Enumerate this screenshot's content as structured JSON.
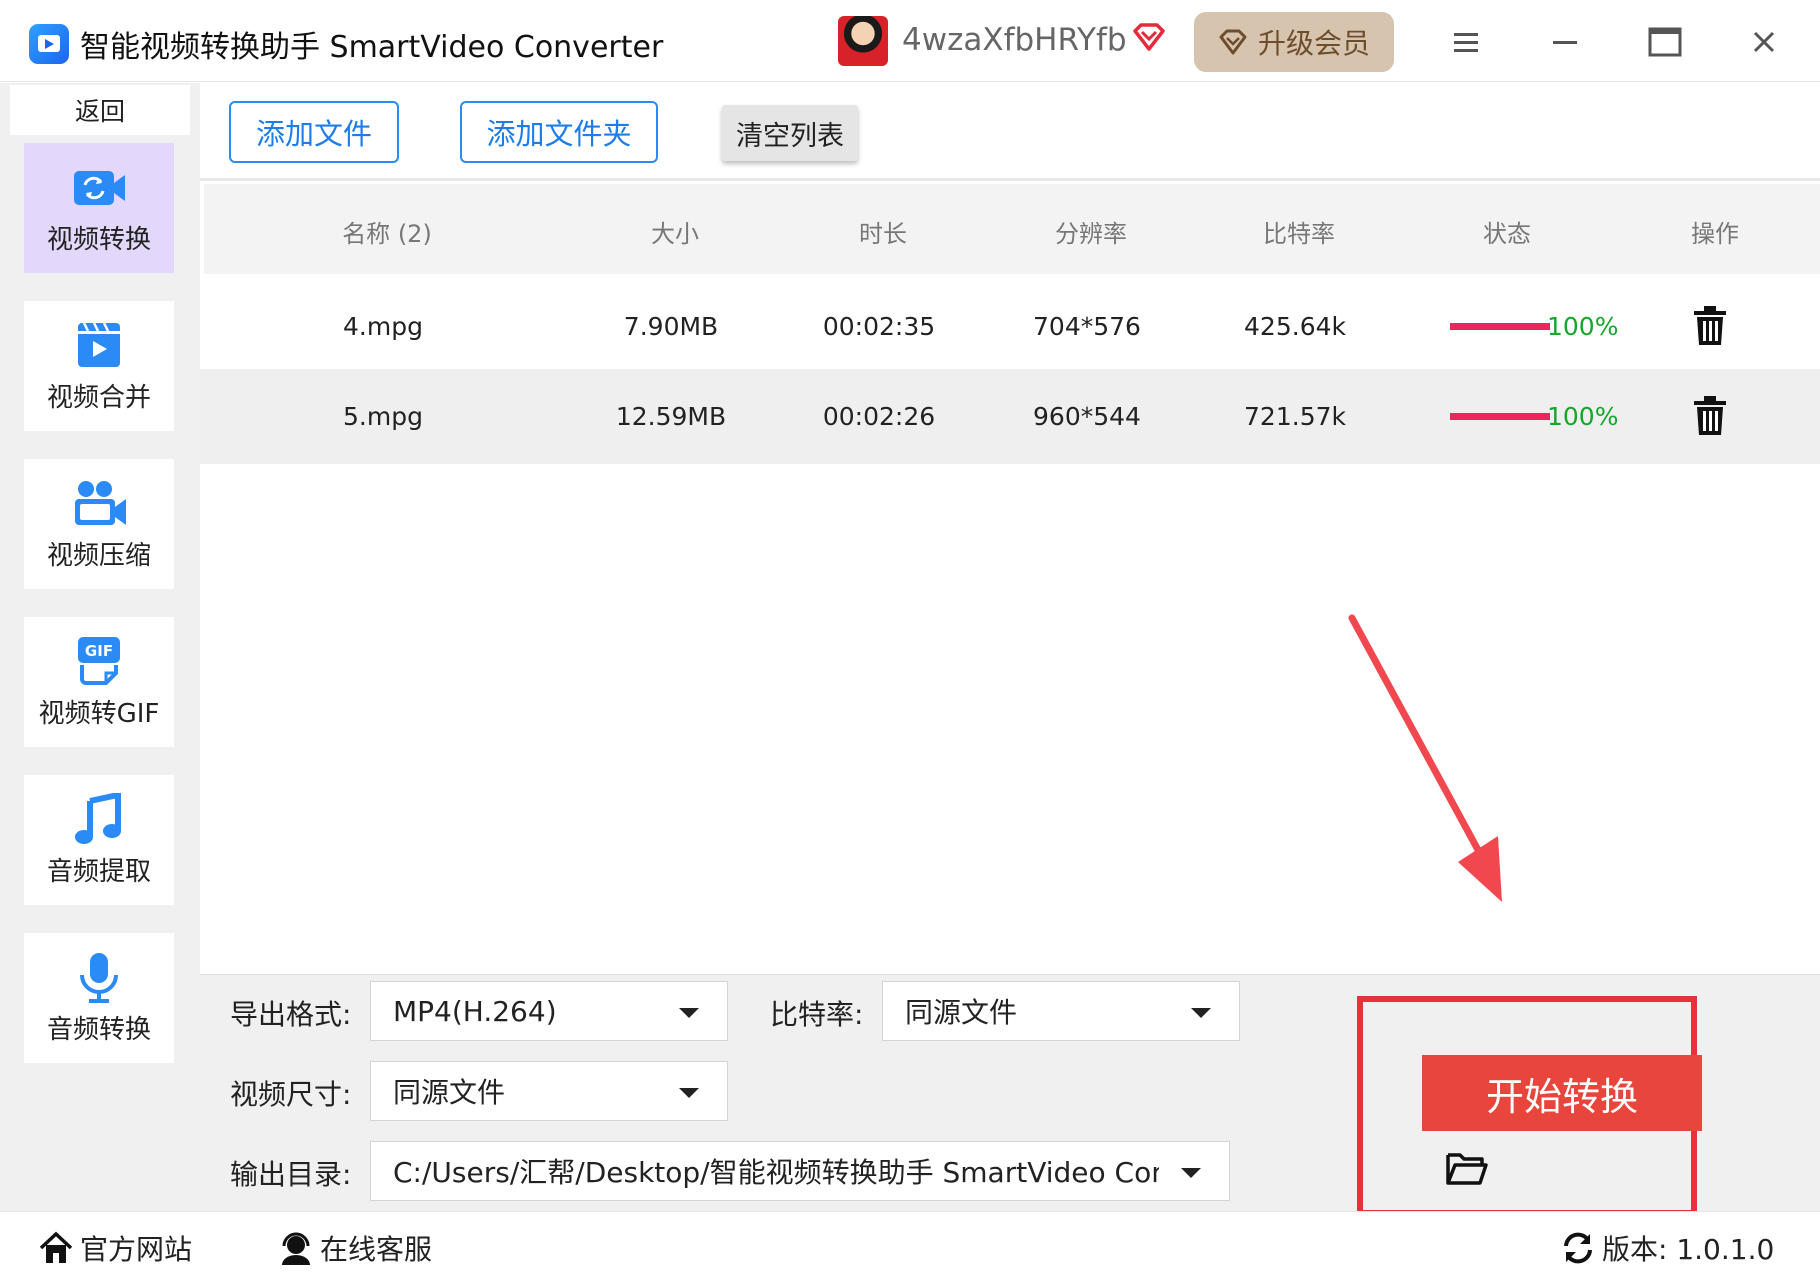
{
  "titlebar": {
    "title": "智能视频转换助手 SmartVideo Converter",
    "username": "4wzaXfbHRYfb",
    "upgrade_label": "升级会员"
  },
  "sidebar": {
    "back_label": "返回",
    "items": [
      {
        "label": "视频转换",
        "icon": "video-convert-icon",
        "active": true
      },
      {
        "label": "视频合并",
        "icon": "video-merge-icon",
        "active": false
      },
      {
        "label": "视频压缩",
        "icon": "video-compress-icon",
        "active": false
      },
      {
        "label": "视频转GIF",
        "icon": "gif-icon",
        "active": false
      },
      {
        "label": "音频提取",
        "icon": "music-note-icon",
        "active": false
      },
      {
        "label": "音频转换",
        "icon": "microphone-icon",
        "active": false
      }
    ]
  },
  "toolbar": {
    "add_file": "添加文件",
    "add_folder": "添加文件夹",
    "clear_list": "清空列表"
  },
  "table": {
    "headers": [
      "名称 (2)",
      "大小",
      "时长",
      "分辨率",
      "比特率",
      "状态",
      "操作"
    ],
    "rows": [
      {
        "name": "4.mpg",
        "size": "7.90MB",
        "duration": "00:02:35",
        "resolution": "704*576",
        "bitrate": "425.64k",
        "progress": 100,
        "progress_text": "100%"
      },
      {
        "name": "5.mpg",
        "size": "12.59MB",
        "duration": "00:02:26",
        "resolution": "960*544",
        "bitrate": "721.57k",
        "progress": 100,
        "progress_text": "100%"
      }
    ]
  },
  "settings": {
    "format_label": "导出格式:",
    "format_value": "MP4(H.264)",
    "bitrate_label": "比特率:",
    "bitrate_value": "同源文件",
    "size_label": "视频尺寸:",
    "size_value": "同源文件",
    "output_label": "输出目录:",
    "output_value": "C:/Users/汇帮/Desktop/智能视频转换助手 SmartVideo Converter",
    "start_label": "开始转换"
  },
  "statusbar": {
    "website": "官方网站",
    "support": "在线客服",
    "version": "版本: 1.0.1.0"
  },
  "colors": {
    "accent_blue": "#2a8af6",
    "active_nav": "#e3d7fb",
    "start_red": "#e8453c",
    "progress_pink": "#e8275d",
    "progress_text_green": "#13a82a",
    "upgrade_bg": "#d7c4ae"
  }
}
